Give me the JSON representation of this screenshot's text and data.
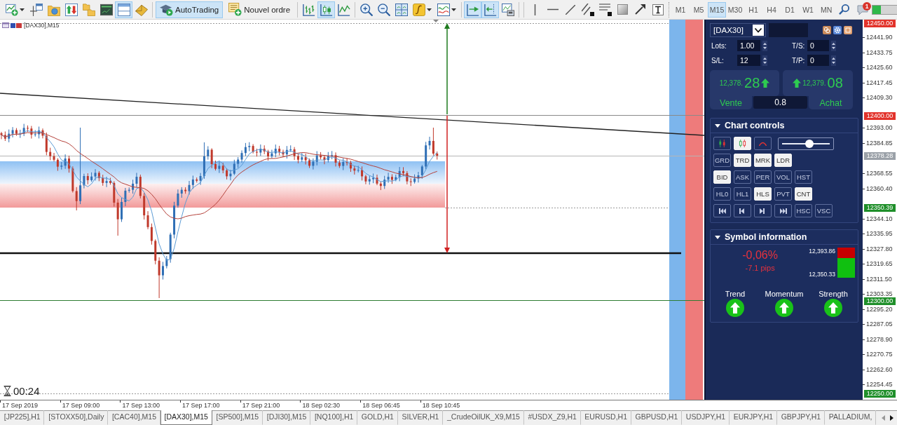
{
  "toolbar": {
    "standard_buttons": [
      {
        "active": false
      },
      {
        "active": false
      },
      {
        "active": false
      },
      {
        "active": false
      },
      {
        "active": false
      },
      {
        "active": false
      },
      {
        "active": true
      },
      {
        "active": false
      }
    ],
    "autotrading": {
      "label": "AutoTrading",
      "active": true
    },
    "new_order": {
      "label": "Nouvel ordre"
    },
    "chart_buttons": [
      {
        "active": false
      },
      {
        "active": true
      },
      {
        "active": false
      },
      {
        "active": false
      },
      {
        "active": false
      },
      {
        "active": false
      },
      {
        "active": false
      },
      {
        "active": false
      },
      {
        "active": true
      },
      {
        "active": true
      },
      {
        "active": false
      }
    ],
    "timeframes": [
      {
        "label": "M1",
        "selected": false
      },
      {
        "label": "M5",
        "selected": false
      },
      {
        "label": "M15",
        "selected": true
      },
      {
        "label": "M30",
        "selected": false
      },
      {
        "label": "H1",
        "selected": false
      },
      {
        "label": "H4",
        "selected": false
      },
      {
        "label": "D1",
        "selected": false
      },
      {
        "label": "W1",
        "selected": false
      },
      {
        "label": "MN",
        "selected": false
      }
    ],
    "notifications": {
      "badge": "1"
    }
  },
  "chart": {
    "title": "[DAX30],M15",
    "countdown": "00:24"
  },
  "trade_panel": {
    "symbol": "[DAX30]",
    "fields": [
      {
        "label": "Lots:",
        "value": "1.00"
      },
      {
        "label": "T/S:",
        "value": "0"
      },
      {
        "label": "S/L:",
        "value": "12"
      },
      {
        "label": "T/P:",
        "value": "0"
      }
    ],
    "sell": {
      "price": "12,378.",
      "pips": "28",
      "rising": true,
      "label": "Vente"
    },
    "buy": {
      "price": "12,379.",
      "pips": "08",
      "rising": true,
      "label": "Achat"
    },
    "spread": "0.8"
  },
  "chart_controls": {
    "title": "Chart controls",
    "expanded": true,
    "style_buttons": [
      {
        "selected": false
      },
      {
        "selected": true
      },
      {
        "selected": false
      }
    ],
    "zoom": {
      "level": 0.58
    },
    "rows": [
      [
        {
          "label": "GRD",
          "selected": false
        },
        {
          "label": "TRD",
          "selected": true
        },
        {
          "label": "MRK",
          "selected": true
        },
        {
          "label": "LDR",
          "selected": true
        }
      ],
      [
        {
          "label": "BID",
          "selected": true
        },
        {
          "label": "ASK",
          "selected": false
        },
        {
          "label": "PER",
          "selected": false
        },
        {
          "label": "VOL",
          "selected": false
        },
        {
          "label": "HST",
          "selected": false
        }
      ],
      [
        {
          "label": "HL0",
          "selected": false
        },
        {
          "label": "HL1",
          "selected": false
        },
        {
          "label": "HLS",
          "selected": true
        },
        {
          "label": "PVT",
          "selected": false
        },
        {
          "label": "CNT",
          "selected": true
        }
      ]
    ],
    "scale_buttons": [
      {
        "label": "HSC",
        "selected": false
      },
      {
        "label": "VSC",
        "selected": false
      }
    ]
  },
  "symbol_information": {
    "title": "Symbol information",
    "expanded": true,
    "change": "-0,06%",
    "pips": "-7.1 pips",
    "high": "12,393.86",
    "low": "12,350.33",
    "range": {
      "level": 0.65
    },
    "signals": [
      {
        "label": "Trend",
        "rising": true
      },
      {
        "label": "Momentum",
        "rising": true
      },
      {
        "label": "Strength",
        "rising": true
      }
    ]
  },
  "price_axis": {
    "ticks": [
      {
        "label": "12441.90"
      },
      {
        "label": "12433.75"
      },
      {
        "label": "12425.60"
      },
      {
        "label": "12417.45"
      },
      {
        "label": "12409.30"
      },
      {
        "label": "12393.00"
      },
      {
        "label": "12384.85"
      },
      {
        "label": "12368.55"
      },
      {
        "label": "12360.40"
      },
      {
        "label": "12344.10"
      },
      {
        "label": "12335.95"
      },
      {
        "label": "12327.80"
      },
      {
        "label": "12319.65"
      },
      {
        "label": "12311.50"
      },
      {
        "label": "12303.35"
      },
      {
        "label": "12295.20"
      },
      {
        "label": "12287.05"
      },
      {
        "label": "12278.90"
      },
      {
        "label": "12270.75"
      },
      {
        "label": "12262.60"
      },
      {
        "label": "12254.45"
      }
    ],
    "tags": [
      {
        "label": "12450.00",
        "color": "#e2332b"
      },
      {
        "label": "12400.00",
        "color": "#e2332b"
      },
      {
        "label": "12378.28",
        "color": "#9ba1a8"
      },
      {
        "label": "12350.39",
        "color": "#1f8f2a"
      },
      {
        "label": "12300.00",
        "color": "#1f8f2a"
      },
      {
        "label": "12250.00",
        "color": "#1f8f2a"
      }
    ]
  },
  "time_axis": {
    "labels": [
      "17 Sep 2019",
      "17 Sep 09:00",
      "17 Sep 13:00",
      "17 Sep 17:00",
      "17 Sep 21:00",
      "18 Sep 02:30",
      "18 Sep 06:45",
      "18 Sep 10:45"
    ]
  },
  "tabs": [
    {
      "label": "[JP225],H1",
      "selected": false
    },
    {
      "label": "[STOXX50],Daily",
      "selected": false
    },
    {
      "label": "[CAC40],M15",
      "selected": false
    },
    {
      "label": "[DAX30],M15",
      "selected": true
    },
    {
      "label": "[SP500],M15",
      "selected": false
    },
    {
      "label": "[DJI30],M15",
      "selected": false
    },
    {
      "label": "[NQ100],H1",
      "selected": false
    },
    {
      "label": "GOLD,H1",
      "selected": false
    },
    {
      "label": "SILVER,H1",
      "selected": false
    },
    {
      "label": "_CrudeOilUK_X9,M15",
      "selected": false
    },
    {
      "label": "#USDX_Z9,H1",
      "selected": false
    },
    {
      "label": "EURUSD,H1",
      "selected": false
    },
    {
      "label": "GBPUSD,H1",
      "selected": false
    },
    {
      "label": "USDJPY,H1",
      "selected": false
    },
    {
      "label": "EURJPY,H1",
      "selected": false
    },
    {
      "label": "GBPJPY,H1",
      "selected": false
    },
    {
      "label": "PALLADIUM,",
      "selected": false
    }
  ]
}
